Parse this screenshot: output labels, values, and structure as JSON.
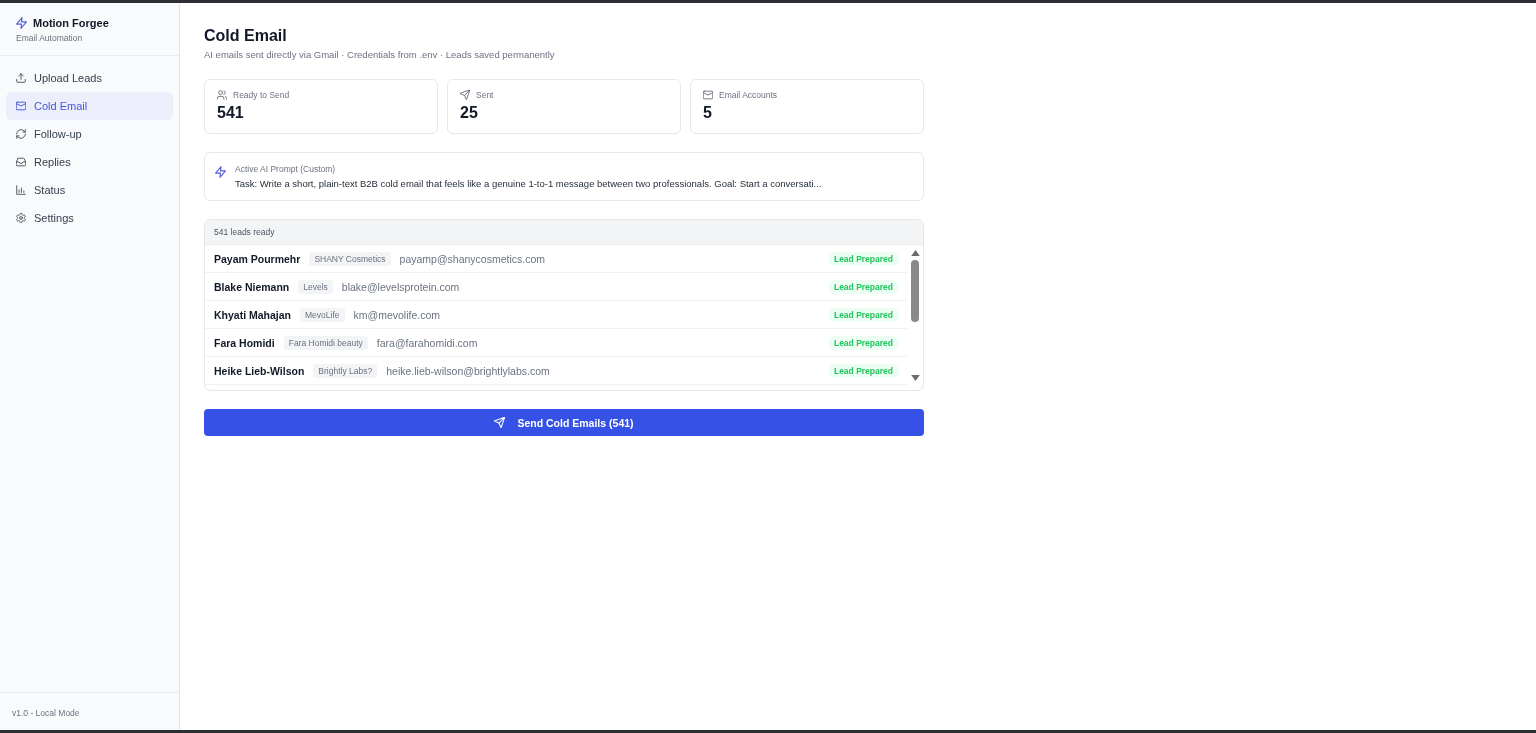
{
  "sidebar": {
    "brand": {
      "name": "Motion Forgee",
      "tagline": "Email Automation"
    },
    "items": [
      {
        "label": "Upload Leads",
        "kind": "upload",
        "selected": false
      },
      {
        "label": "Cold Email",
        "kind": "mail",
        "selected": true
      },
      {
        "label": "Follow-up",
        "kind": "refresh",
        "selected": false
      },
      {
        "label": "Replies",
        "kind": "inbox",
        "selected": false
      },
      {
        "label": "Status",
        "kind": "chart",
        "selected": false
      },
      {
        "label": "Settings",
        "kind": "settings",
        "selected": false
      }
    ],
    "footer": "v1.0 - Local Mode"
  },
  "header": {
    "title": "Cold Email",
    "subtitle": "AI emails sent directly via Gmail · Credentials from .env · Leads saved permanently"
  },
  "stats": [
    {
      "label": "Ready to Send",
      "value": "541",
      "kind": "users"
    },
    {
      "label": "Sent",
      "value": "25",
      "kind": "send"
    },
    {
      "label": "Email Accounts",
      "value": "5",
      "kind": "mail"
    }
  ],
  "prompt": {
    "title": "Active AI Prompt (Custom)",
    "text": "Task: Write a short, plain-text B2B cold email that feels like a genuine 1-to-1 message between two professionals. Goal: Start a conversati..."
  },
  "leads": {
    "count": "541 leads ready",
    "rows": [
      {
        "name": "Payam Pourmehr",
        "company": "SHANY Cosmetics",
        "email": "payamp@shanycosmetics.com",
        "status": "Lead Prepared"
      },
      {
        "name": "Blake Niemann",
        "company": "Levels",
        "email": "blake@levelsprotein.com",
        "status": "Lead Prepared"
      },
      {
        "name": "Khyati Mahajan",
        "company": "MevoLife",
        "email": "km@mevolife.com",
        "status": "Lead Prepared"
      },
      {
        "name": "Fara Homidi",
        "company": "Fara Homidi beauty",
        "email": "fara@farahomidi.com",
        "status": "Lead Prepared"
      },
      {
        "name": "Heike Lieb-Wilson",
        "company": "Brightly Labs?",
        "email": "heike.lieb-wilson@brightlylabs.com",
        "status": "Lead Prepared"
      }
    ]
  },
  "send_button": {
    "label": "Send Cold Emails (541)"
  }
}
